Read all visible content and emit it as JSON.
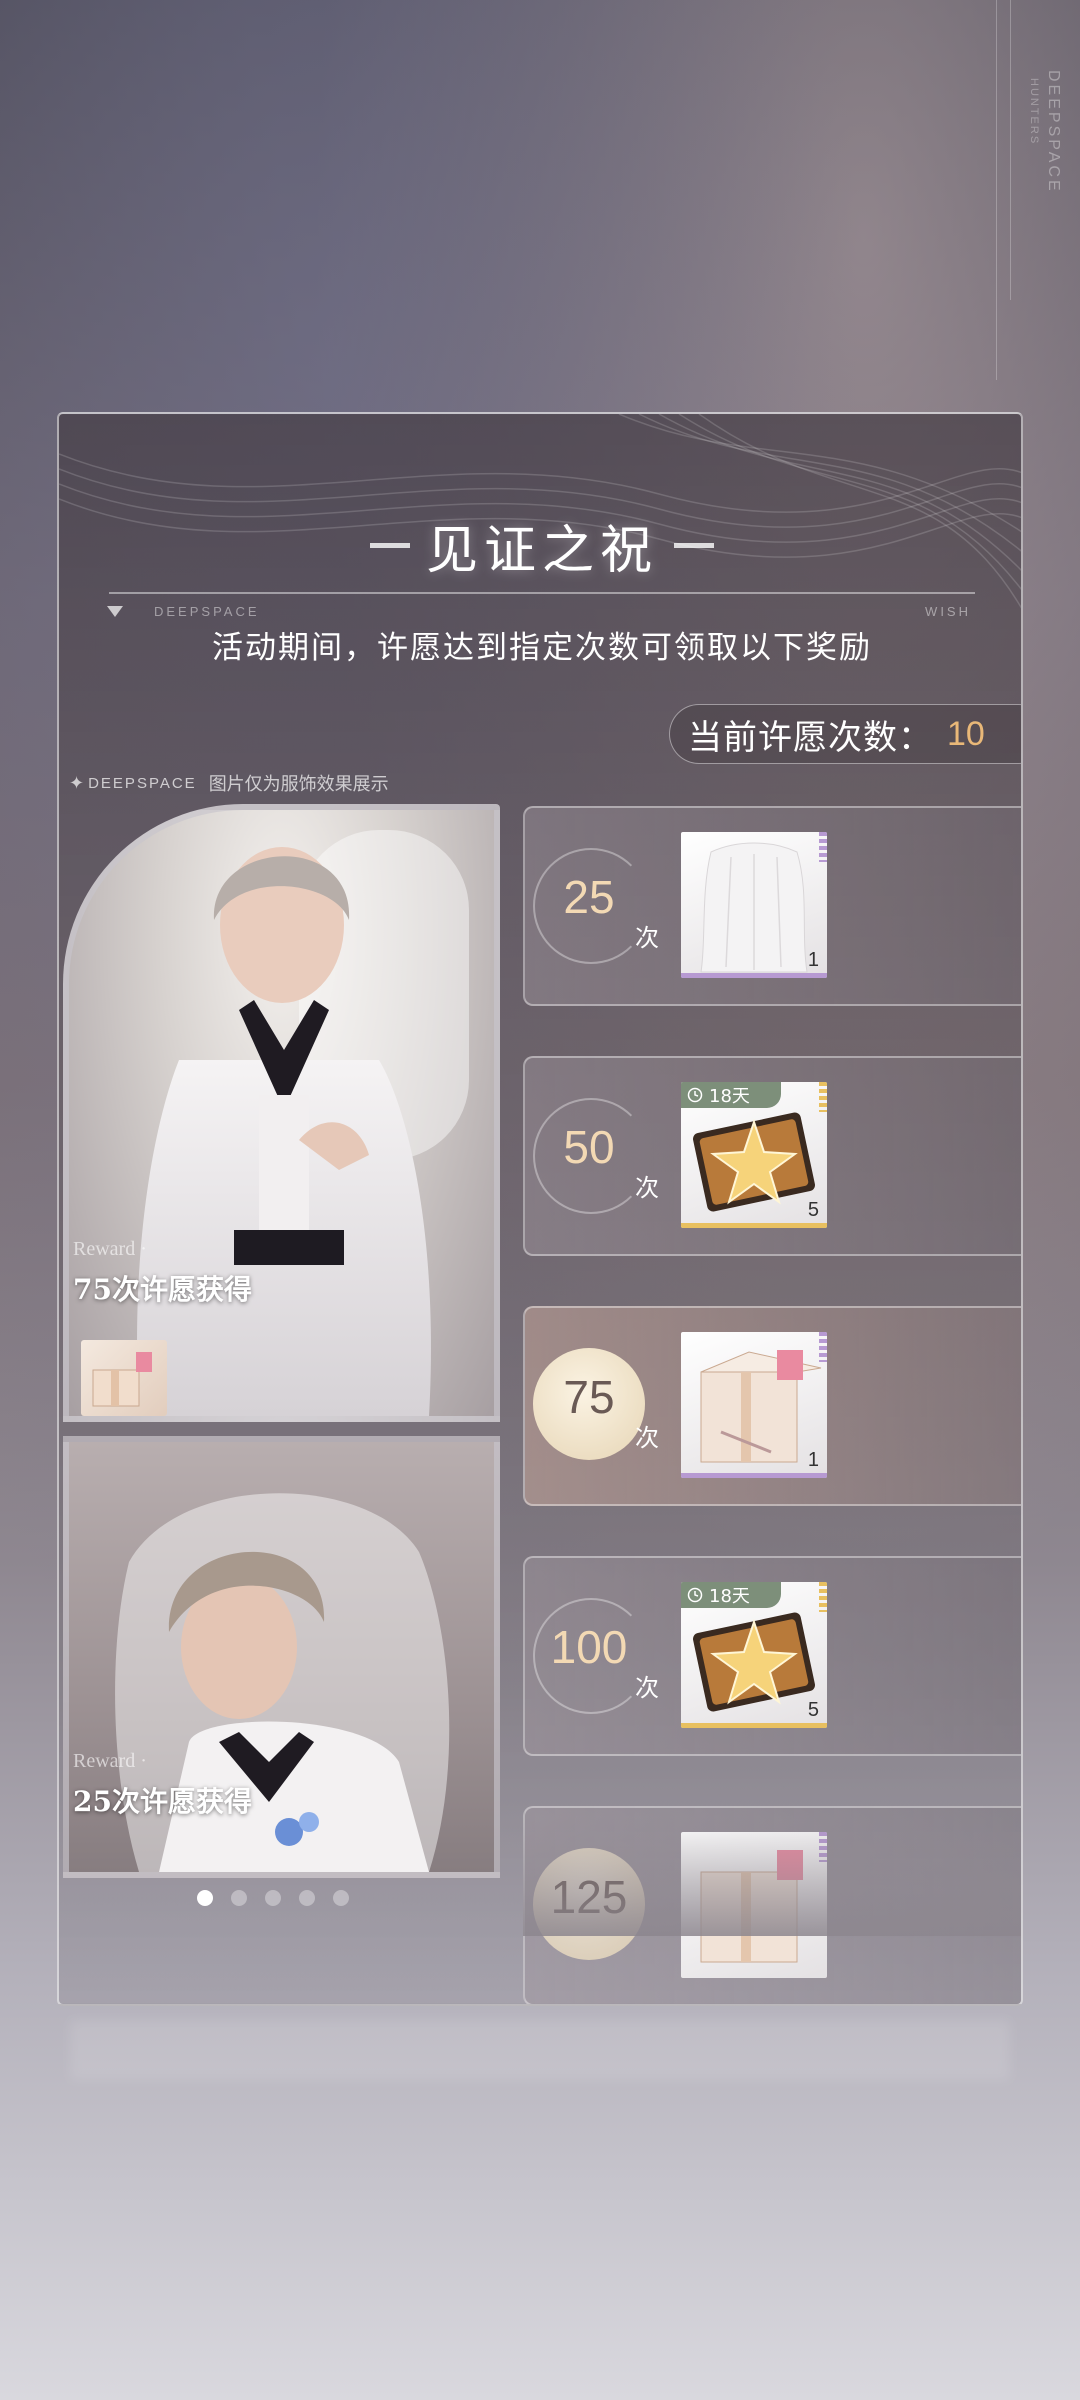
{
  "background": {
    "brand_vertical": "DEEPSPACE",
    "brand_vertical_small": "HUNTERS"
  },
  "panel": {
    "title": "见证之祝",
    "divider_left": "DEEPSPACE",
    "divider_right": "WISH",
    "subtitle": "活动期间，许愿达到指定次数可领取以下奖励",
    "count_label": "当前许愿次数：",
    "count_value": "10",
    "note_brand": "DEEPSPACE",
    "note_text": "图片仅为服饰效果展示"
  },
  "showcase": [
    {
      "reward_small": "Reward ·",
      "reward_big": "75次许愿获得"
    },
    {
      "reward_small": "Reward ·",
      "reward_big": "25次许愿获得"
    }
  ],
  "carousel": {
    "total": 5,
    "active_index": 0
  },
  "rewards": [
    {
      "milestone": "25",
      "unit": "次",
      "quantity": "1",
      "item": "veil-icon",
      "rarity_color": "#b79ad2",
      "reached": false
    },
    {
      "milestone": "50",
      "unit": "次",
      "quantity": "5",
      "item": "star-ticket-icon",
      "timer": "18天",
      "rarity_color": "#e8c060",
      "reached": false
    },
    {
      "milestone": "75",
      "unit": "次",
      "quantity": "1",
      "item": "gift-box-icon",
      "rarity_color": "#b79ad2",
      "reached": false,
      "highlighted": true
    },
    {
      "milestone": "100",
      "unit": "次",
      "quantity": "5",
      "item": "star-ticket-icon",
      "timer": "18天",
      "rarity_color": "#e8c060",
      "reached": false
    },
    {
      "milestone": "125",
      "unit": "次",
      "quantity": "",
      "item": "gift-box-icon",
      "rarity_color": "#b79ad2",
      "reached": false
    }
  ],
  "colors": {
    "count_value": "#e9b878",
    "milestone_text": "#f3d9b4"
  }
}
